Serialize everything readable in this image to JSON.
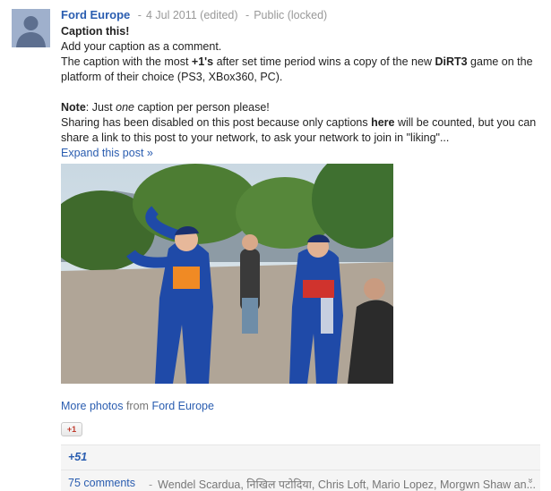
{
  "post": {
    "author": "Ford Europe",
    "date": "4 Jul 2011 (edited)",
    "visibility": "Public (locked)",
    "separator": "-",
    "title": "Caption this!",
    "line1": "Add your caption as a comment.",
    "line2_a": "The caption with the most ",
    "line2_b": "+1's",
    "line2_c": " after set time period wins a copy of the new ",
    "line2_d": "DiRT3",
    "line2_e": " game on the platform of their choice (PS3, XBox360, PC).",
    "note_label": "Note",
    "note_a": ": Just ",
    "note_em": "one",
    "note_b": " caption per person please!",
    "share_a": "Sharing has been disabled on this post because only captions ",
    "share_b": "here",
    "share_c": " will be counted, but you can share a link to this post to your network, to ask your network to join in \"liking\"...",
    "expand": "Expand this post »"
  },
  "photos": {
    "more": "More photos",
    "from": " from ",
    "source": "Ford Europe"
  },
  "plusone": {
    "button": "+1",
    "count": "+51"
  },
  "comments": {
    "count": "75 comments",
    "separator": "-",
    "names": "Wendel Scardua, निखिल पटोदिया, Chris Loft, Mario Lopez, Morgwn Shaw an...",
    "chevron": "»"
  },
  "colors": {
    "link": "#2a5db0",
    "meta": "#999999",
    "bar": "#f5f5f5"
  }
}
